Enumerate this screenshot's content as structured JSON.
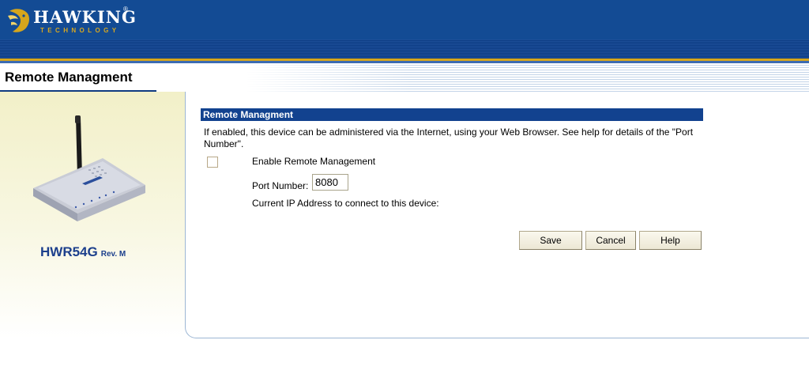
{
  "header": {
    "brand_name": "HAWKING",
    "brand_registered": "®",
    "brand_sub": "TECHNOLOGY",
    "brand_colors": {
      "header_bg": "#134b94",
      "gold": "#d6a61c"
    }
  },
  "page": {
    "title": "Remote Managment"
  },
  "left_panel": {
    "model": "HWR54G",
    "revision": "Rev. M",
    "device_image": "wireless-router-icon"
  },
  "section": {
    "title": "Remote Managment",
    "description": "If enabled, this device can be administered via the Internet, using your Web Browser. See help for details of the \"Port Number\".",
    "enable_label": "Enable Remote Management",
    "enable_checked": false,
    "port_label": "Port Number:",
    "port_value": "8080",
    "ip_label": "Current IP Address to connect to this device:"
  },
  "buttons": {
    "save": "Save",
    "cancel": "Cancel",
    "help": "Help"
  }
}
